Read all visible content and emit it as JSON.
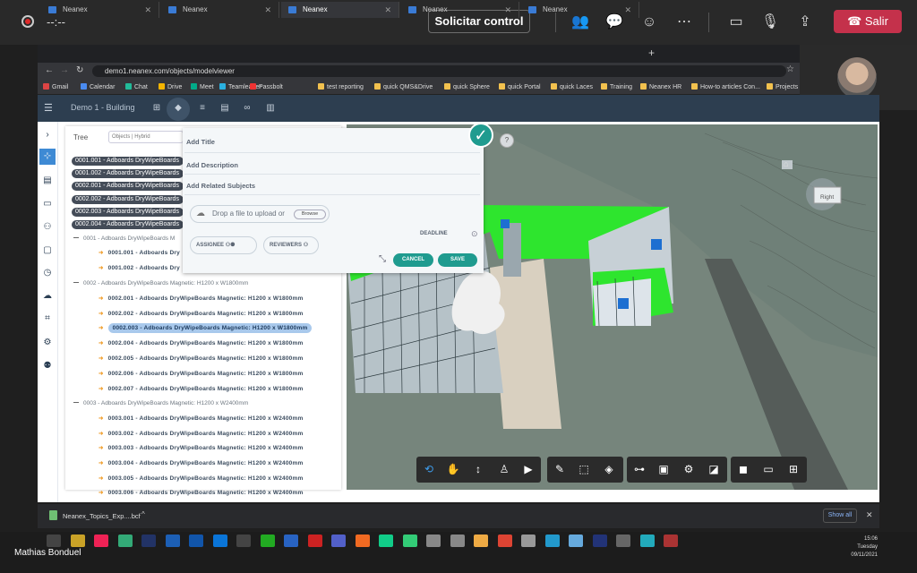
{
  "meeting": {
    "timer": "--:--",
    "request_control": "Solicitar control",
    "leave": "Salir",
    "presenter_name": "Mathias Bonduel"
  },
  "browser": {
    "tabs": [
      {
        "label": "Neanex",
        "close": "✕"
      },
      {
        "label": "Neanex",
        "close": "✕"
      },
      {
        "label": "Neanex",
        "close": "✕"
      },
      {
        "label": "Neanex",
        "close": "✕"
      },
      {
        "label": "Neanex",
        "close": "✕"
      }
    ],
    "new_tab": "+",
    "url": "demo1.neanex.com/objects/modelviewer",
    "bookmarks": [
      "Gmail",
      "Calendar",
      "Chat",
      "Drive",
      "Meet",
      "Teamleader",
      "Passbolt",
      "test reporting",
      "quick QMS&Drive",
      "quick Sphere",
      "quick Portal",
      "quick Laces",
      "Training",
      "Neanex HR",
      "How-to articles Con...",
      "Projects"
    ]
  },
  "app": {
    "project": "Demo 1 - Building",
    "tree": {
      "title": "Tree",
      "filter": "Objects | Hybrid",
      "pills": [
        "0001.001 - Adboards DryWipeBoards",
        "0001.002 - Adboards DryWipeBoards",
        "0002.001 - Adboards DryWipeBoards",
        "0002.002 - Adboards DryWipeBoards",
        "0002.003 - Adboards DryWipeBoards",
        "0002.004 - Adboards DryWipeBoards"
      ],
      "group1": "0001 - Adboards DryWipeBoards M",
      "group1_items": [
        "0001.001 - Adboards Dry",
        "0001.002 - Adboards Dry"
      ],
      "group2": "0002 - Adboards DryWipeBoards Magnetic: H1200 x W1800mm",
      "group2_items": [
        "0002.001 - Adboards DryWipeBoards Magnetic: H1200 x W1800mm",
        "0002.002 - Adboards DryWipeBoards Magnetic: H1200 x W1800mm",
        "0002.003 - Adboards DryWipeBoards Magnetic: H1200 x W1800mm",
        "0002.004 - Adboards DryWipeBoards Magnetic: H1200 x W1800mm",
        "0002.005 - Adboards DryWipeBoards Magnetic: H1200 x W1800mm",
        "0002.006 - Adboards DryWipeBoards Magnetic: H1200 x W1800mm",
        "0002.007 - Adboards DryWipeBoards Magnetic: H1200 x W1800mm"
      ],
      "group3": "0003 - Adboards DryWipeBoards Magnetic: H1200 x W2400mm",
      "group3_items": [
        "0003.001 - Adboards DryWipeBoards Magnetic: H1200 x W2400mm",
        "0003.002 - Adboards DryWipeBoards Magnetic: H1200 x W2400mm",
        "0003.003 - Adboards DryWipeBoards Magnetic: H1200 x W2400mm",
        "0003.004 - Adboards DryWipeBoards Magnetic: H1200 x W2400mm",
        "0003.005 - Adboards DryWipeBoards Magnetic: H1200 x W2400mm",
        "0003.006 - Adboards DryWipeBoards Magnetic: H1200 x W2400mm"
      ]
    },
    "form": {
      "title": "Add Title",
      "description": "Add Description",
      "related": "Add Related Subjects",
      "drop": "Drop a file to upload or",
      "browse": "Browse",
      "assignee": "ASSIGNEE",
      "reviewers": "REVIEWERS",
      "deadline": "DEADLINE",
      "cancel": "CANCEL",
      "save": "SAVE"
    },
    "viewcube": "Right"
  },
  "downloads": {
    "file": "Neanex_Topics_Exp....bcf",
    "show_all": "Show all"
  },
  "taskbar": {
    "time": "15:06",
    "day": "Tuesday",
    "date": "09/11/2021"
  }
}
